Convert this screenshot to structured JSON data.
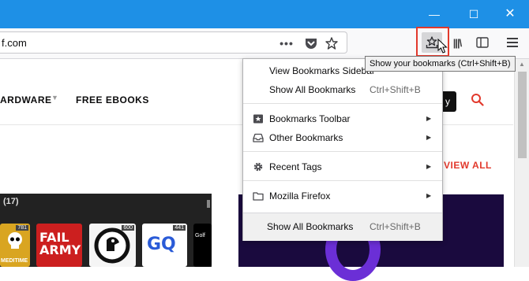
{
  "window": {
    "minimize_glyph": "—",
    "maximize_glyph": "☐",
    "close_glyph": "✕"
  },
  "urlbar": {
    "text": "f.com",
    "page_actions_glyph": "•••"
  },
  "toolbar": {
    "library_glyph": "|||\\"
  },
  "tooltip": "Show your bookmarks (Ctrl+Shift+B)",
  "site": {
    "nav": [
      "ARDWARE",
      "FREE EBOOKS"
    ],
    "view_all": "VIEW ALL",
    "button_fragment": "y",
    "podcasts_count": "(17)",
    "tiles": [
      {
        "badge": "781",
        "label": "MEDITIME"
      },
      {
        "badge": "",
        "label": "FAIL ARMY"
      },
      {
        "badge": "600",
        "label": ""
      },
      {
        "badge": "441",
        "label": "GQ"
      },
      {
        "badge": "",
        "label": "Golf"
      }
    ]
  },
  "menu": {
    "items": [
      {
        "label": "View Bookmarks Sidebar",
        "shortcut": "",
        "icon": ""
      },
      {
        "label": "Show All Bookmarks",
        "shortcut": "Ctrl+Shift+B",
        "icon": ""
      },
      {
        "label": "Bookmarks Toolbar",
        "shortcut": "",
        "icon": "star-folder-icon",
        "submenu": true
      },
      {
        "label": "Other Bookmarks",
        "shortcut": "",
        "icon": "tray-icon",
        "submenu": true
      },
      {
        "label": "Recent Tags",
        "shortcut": "",
        "icon": "gear-icon",
        "submenu": true
      },
      {
        "label": "Mozilla Firefox",
        "shortcut": "",
        "icon": "folder-icon",
        "submenu": true
      }
    ],
    "footer": {
      "label": "Show All Bookmarks",
      "shortcut": "Ctrl+Shift+B"
    }
  },
  "colors": {
    "titlebar": "#1e90e6",
    "highlight_box": "#e2392c",
    "accent_red": "#e2392c",
    "purple": "#6b2fd6"
  }
}
